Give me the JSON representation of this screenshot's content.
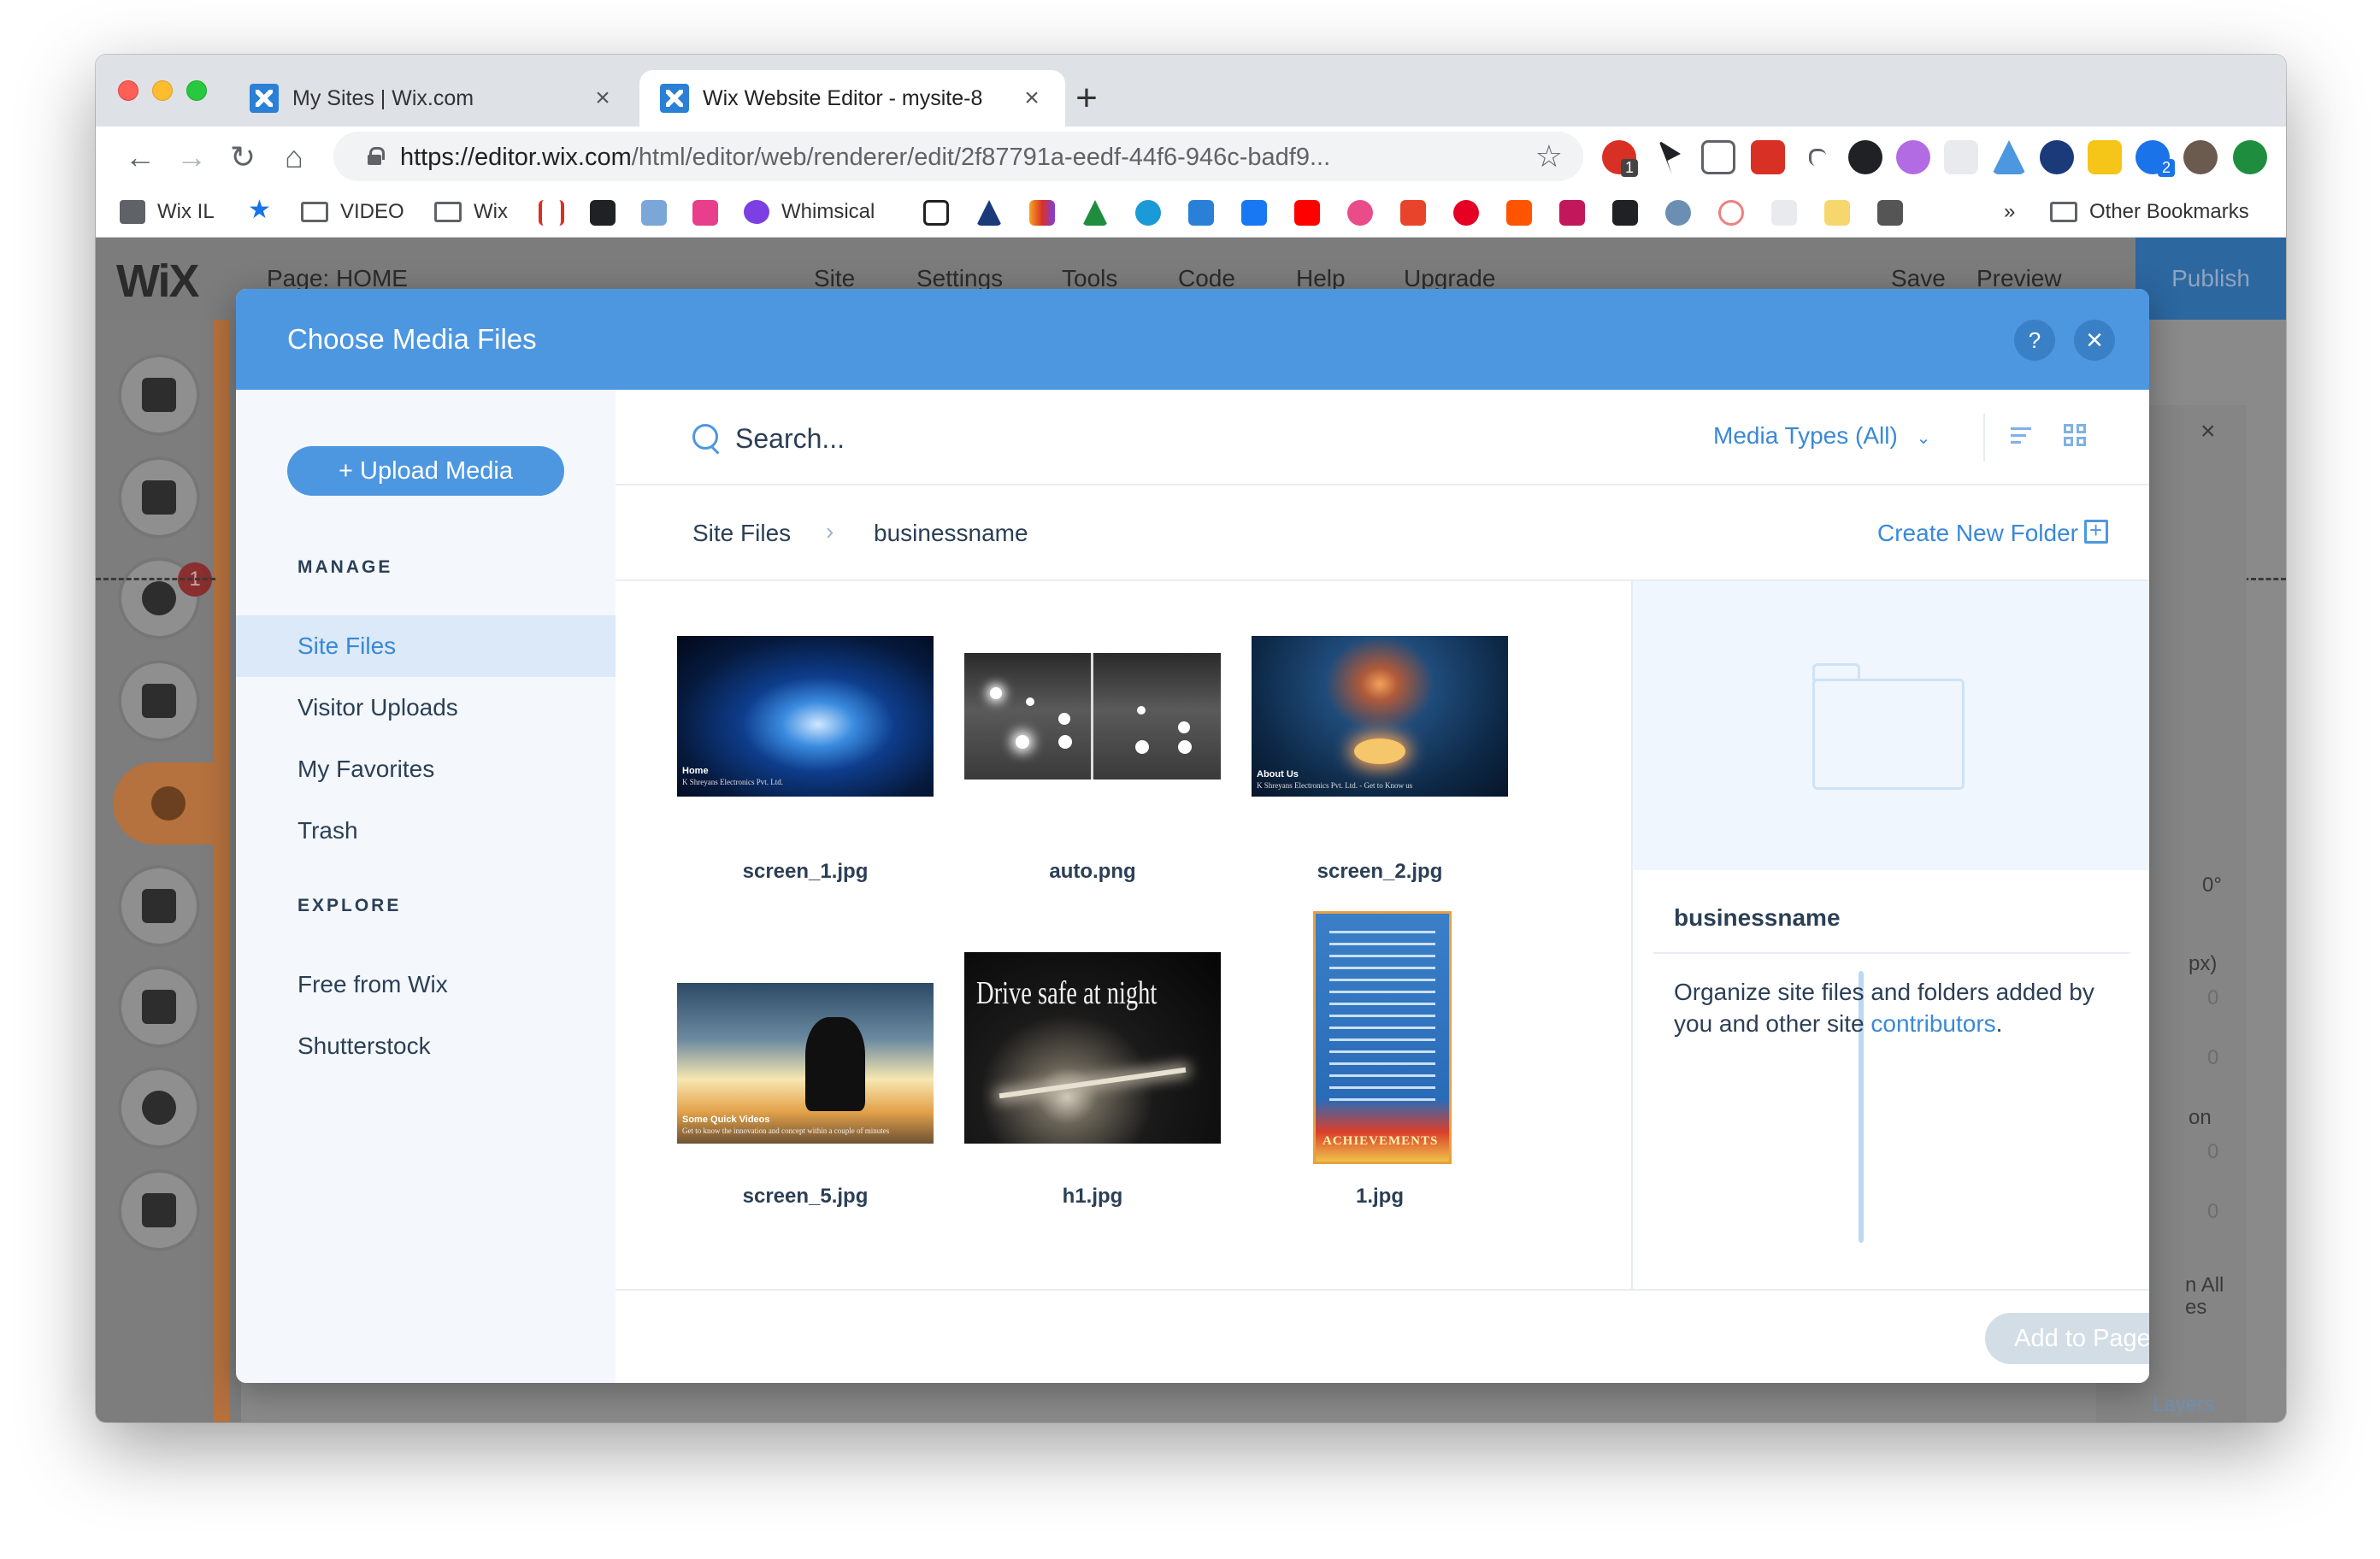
{
  "browser": {
    "tabs": [
      {
        "title": "My Sites | Wix.com"
      },
      {
        "title": "Wix Website Editor - mysite-8"
      }
    ],
    "url_host": "https://editor.wix.com",
    "url_path": "/html/editor/web/renderer/edit/2f87791a-eedf-44f6-946c-badf9...",
    "extension_badges": [
      "1",
      "2"
    ],
    "bookmarks": {
      "wix_il": "Wix IL",
      "video": "VIDEO",
      "wix": "Wix",
      "whimsical": "Whimsical",
      "more": "»",
      "other": "Other Bookmarks"
    }
  },
  "editor": {
    "logo": "WiX",
    "page_label": "Page: HOME",
    "menu": [
      "Site",
      "Settings",
      "Tools",
      "Code",
      "Help",
      "Upgrade"
    ],
    "save": "Save",
    "preview": "Preview",
    "publish": "Publish",
    "apps_badge": "1",
    "right_panel": {
      "rotation": "0°",
      "px": "px)",
      "values": [
        "0",
        "0",
        "0",
        "0"
      ],
      "on": "on",
      "show_all": "n All",
      "es": "es",
      "layers": "Layers"
    }
  },
  "dialog": {
    "title": "Choose Media Files",
    "help": "?",
    "close": "×",
    "upload_button": "+ Upload Media",
    "manage_heading": "MANAGE",
    "manage_items": [
      "Site Files",
      "Visitor Uploads",
      "My Favorites",
      "Trash"
    ],
    "explore_heading": "EXPLORE",
    "explore_items": [
      "Free from Wix",
      "Shutterstock"
    ],
    "search_placeholder": "Search...",
    "media_types": "Media Types (All)",
    "breadcrumb": [
      "Site Files",
      "businessname"
    ],
    "create_folder": "Create New Folder",
    "files": [
      {
        "name": "screen_1.jpg",
        "caption": "Home",
        "subcaption": "K Shreyans Electronics Pvt. Ltd."
      },
      {
        "name": "auto.png"
      },
      {
        "name": "screen_2.jpg",
        "caption": "About Us",
        "subcaption": "K Shreyans Electronics Pvt. Ltd. - Get to Know us"
      },
      {
        "name": "screen_5.jpg",
        "caption": "Some Quick Videos",
        "subcaption": "Get to know the innovation and concept within a couple of minutes"
      },
      {
        "name": "h1.jpg",
        "caption": "Drive safe at night"
      },
      {
        "name": "1.jpg",
        "caption": "ACHIEVEMENTS"
      }
    ],
    "info": {
      "folder_name": "businessname",
      "description": "Organize site files and folders added by you and other site ",
      "link": "contributors",
      "end": "."
    },
    "add_button": "Add to Page"
  },
  "colors": {
    "accent": "#4d97e0",
    "link": "#3a88d8",
    "text": "#2b3f55",
    "sidebar_bg": "#f4f8fc",
    "selected_bg": "#dbe9f8"
  }
}
